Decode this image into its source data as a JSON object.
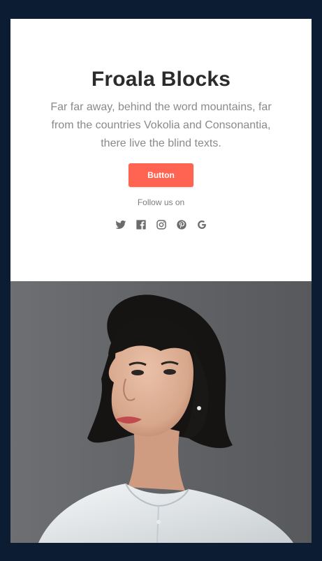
{
  "hero": {
    "title": "Froala Blocks",
    "description": "Far far away, behind the word mountains, far from the countries Vokolia and Consonantia, there live the blind texts.",
    "button_label": "Button",
    "follow_label": "Follow us on"
  },
  "social_links": [
    {
      "icon": "twitter-icon"
    },
    {
      "icon": "facebook-icon"
    },
    {
      "icon": "instagram-icon"
    },
    {
      "icon": "pinterest-icon"
    },
    {
      "icon": "google-icon"
    }
  ],
  "photo": {
    "subject": "portrait of a woman with short dark hair"
  },
  "colors": {
    "page_background": "#0b1c33",
    "card_background": "#ffffff",
    "button_background": "#ff6452",
    "icon_color": "#6b6b6b"
  }
}
